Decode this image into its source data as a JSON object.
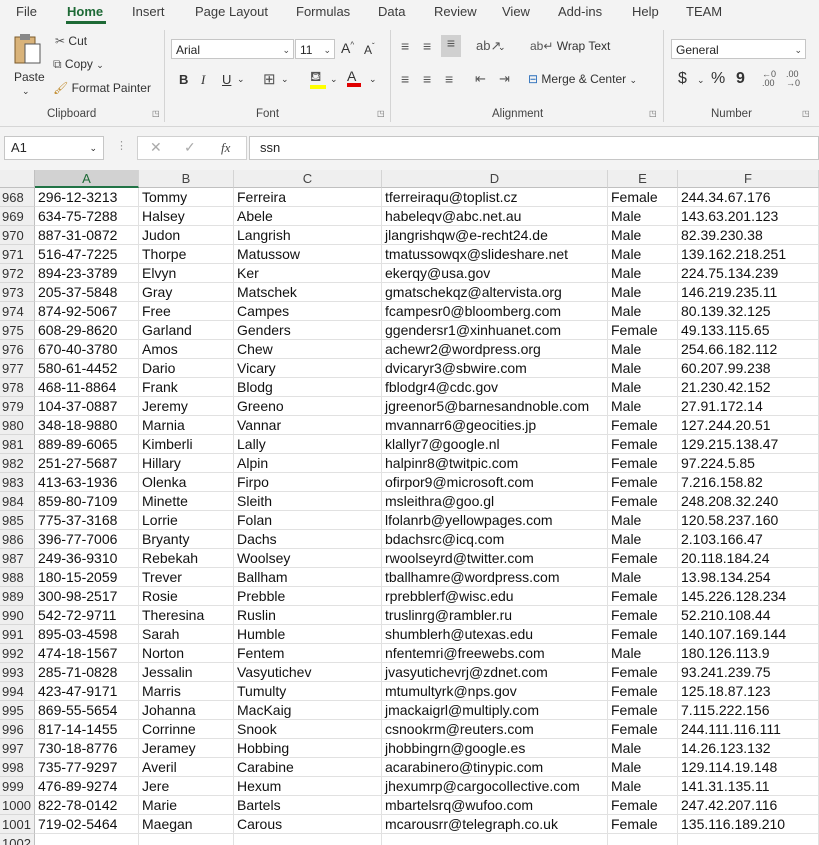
{
  "tabs": [
    "File",
    "Home",
    "Insert",
    "Page Layout",
    "Formulas",
    "Data",
    "Review",
    "View",
    "Add-ins",
    "Help",
    "TEAM"
  ],
  "active_tab": "Home",
  "clipboard": {
    "paste": "Paste",
    "cut": "Cut",
    "copy": "Copy",
    "format_painter": "Format Painter",
    "label": "Clipboard"
  },
  "font": {
    "name": "Arial",
    "size": "11",
    "bold": "B",
    "italic": "I",
    "underline": "U",
    "label": "Font"
  },
  "alignment": {
    "wrap": "Wrap Text",
    "merge": "Merge & Center",
    "label": "Alignment"
  },
  "number": {
    "format": "General",
    "currency": "$",
    "percent": "%",
    "comma": "9",
    "label": "Number"
  },
  "formula_bar": {
    "name_box": "A1",
    "fx": "fx",
    "content": "ssn"
  },
  "columns": [
    "A",
    "B",
    "C",
    "D",
    "E",
    "F"
  ],
  "rows": [
    {
      "n": "968",
      "cells": [
        "296-12-3213",
        "Tommy",
        "Ferreira",
        "tferreiraqu@toplist.cz",
        "Female",
        "244.34.67.176"
      ]
    },
    {
      "n": "969",
      "cells": [
        "634-75-7288",
        "Halsey",
        "Abele",
        "habeleqv@abc.net.au",
        "Male",
        "143.63.201.123"
      ]
    },
    {
      "n": "970",
      "cells": [
        "887-31-0872",
        "Judon",
        "Langrish",
        "jlangrishqw@e-recht24.de",
        "Male",
        "82.39.230.38"
      ]
    },
    {
      "n": "971",
      "cells": [
        "516-47-7225",
        "Thorpe",
        "Matussow",
        "tmatussowqx@slideshare.net",
        "Male",
        "139.162.218.251"
      ]
    },
    {
      "n": "972",
      "cells": [
        "894-23-3789",
        "Elvyn",
        "Ker",
        "ekerqy@usa.gov",
        "Male",
        "224.75.134.239"
      ]
    },
    {
      "n": "973",
      "cells": [
        "205-37-5848",
        "Gray",
        "Matschek",
        "gmatschekqz@altervista.org",
        "Male",
        "146.219.235.11"
      ]
    },
    {
      "n": "974",
      "cells": [
        "874-92-5067",
        "Free",
        "Campes",
        "fcampesr0@bloomberg.com",
        "Male",
        "80.139.32.125"
      ]
    },
    {
      "n": "975",
      "cells": [
        "608-29-8620",
        "Garland",
        "Genders",
        "ggendersr1@xinhuanet.com",
        "Female",
        "49.133.115.65"
      ]
    },
    {
      "n": "976",
      "cells": [
        "670-40-3780",
        "Amos",
        "Chew",
        "achewr2@wordpress.org",
        "Male",
        "254.66.182.112"
      ]
    },
    {
      "n": "977",
      "cells": [
        "580-61-4452",
        "Dario",
        "Vicary",
        "dvicaryr3@sbwire.com",
        "Male",
        "60.207.99.238"
      ]
    },
    {
      "n": "978",
      "cells": [
        "468-11-8864",
        "Frank",
        "Blodg",
        "fblodgr4@cdc.gov",
        "Male",
        "21.230.42.152"
      ]
    },
    {
      "n": "979",
      "cells": [
        "104-37-0887",
        "Jeremy",
        "Greeno",
        "jgreenor5@barnesandnoble.com",
        "Male",
        "27.91.172.14"
      ]
    },
    {
      "n": "980",
      "cells": [
        "348-18-9880",
        "Marnia",
        "Vannar",
        "mvannarr6@geocities.jp",
        "Female",
        "127.244.20.51"
      ]
    },
    {
      "n": "981",
      "cells": [
        "889-89-6065",
        "Kimberli",
        "Lally",
        "klallyr7@google.nl",
        "Female",
        "129.215.138.47"
      ]
    },
    {
      "n": "982",
      "cells": [
        "251-27-5687",
        "Hillary",
        "Alpin",
        "halpinr8@twitpic.com",
        "Female",
        "97.224.5.85"
      ]
    },
    {
      "n": "983",
      "cells": [
        "413-63-1936",
        "Olenka",
        "Firpo",
        "ofirpor9@microsoft.com",
        "Female",
        "7.216.158.82"
      ]
    },
    {
      "n": "984",
      "cells": [
        "859-80-7109",
        "Minette",
        "Sleith",
        "msleithra@goo.gl",
        "Female",
        "248.208.32.240"
      ]
    },
    {
      "n": "985",
      "cells": [
        "775-37-3168",
        "Lorrie",
        "Folan",
        "lfolanrb@yellowpages.com",
        "Male",
        "120.58.237.160"
      ]
    },
    {
      "n": "986",
      "cells": [
        "396-77-7006",
        "Bryanty",
        "Dachs",
        "bdachsrc@icq.com",
        "Male",
        "2.103.166.47"
      ]
    },
    {
      "n": "987",
      "cells": [
        "249-36-9310",
        "Rebekah",
        "Woolsey",
        "rwoolseyrd@twitter.com",
        "Female",
        "20.118.184.24"
      ]
    },
    {
      "n": "988",
      "cells": [
        "180-15-2059",
        "Trever",
        "Ballham",
        "tballhamre@wordpress.com",
        "Male",
        "13.98.134.254"
      ]
    },
    {
      "n": "989",
      "cells": [
        "300-98-2517",
        "Rosie",
        "Prebble",
        "rprebblerf@wisc.edu",
        "Female",
        "145.226.128.234"
      ]
    },
    {
      "n": "990",
      "cells": [
        "542-72-9711",
        "Theresina",
        "Ruslin",
        "truslinrg@rambler.ru",
        "Female",
        "52.210.108.44"
      ]
    },
    {
      "n": "991",
      "cells": [
        "895-03-4598",
        "Sarah",
        "Humble",
        "shumblerh@utexas.edu",
        "Female",
        "140.107.169.144"
      ]
    },
    {
      "n": "992",
      "cells": [
        "474-18-1567",
        "Norton",
        "Fentem",
        "nfentemri@freewebs.com",
        "Male",
        "180.126.113.9"
      ]
    },
    {
      "n": "993",
      "cells": [
        "285-71-0828",
        "Jessalin",
        "Vasyutichev",
        "jvasyutichevrj@zdnet.com",
        "Female",
        "93.241.239.75"
      ]
    },
    {
      "n": "994",
      "cells": [
        "423-47-9171",
        "Marris",
        "Tumulty",
        "mtumultyrk@nps.gov",
        "Female",
        "125.18.87.123"
      ]
    },
    {
      "n": "995",
      "cells": [
        "869-55-5654",
        "Johanna",
        "MacKaig",
        "jmackaigrl@multiply.com",
        "Female",
        "7.115.222.156"
      ]
    },
    {
      "n": "996",
      "cells": [
        "817-14-1455",
        "Corrinne",
        "Snook",
        "csnookrm@reuters.com",
        "Female",
        "244.111.116.111"
      ]
    },
    {
      "n": "997",
      "cells": [
        "730-18-8776",
        "Jeramey",
        "Hobbing",
        "jhobbingrn@google.es",
        "Male",
        "14.26.123.132"
      ]
    },
    {
      "n": "998",
      "cells": [
        "735-77-9297",
        "Averil",
        "Carabine",
        "acarabinero@tinypic.com",
        "Male",
        "129.114.19.148"
      ]
    },
    {
      "n": "999",
      "cells": [
        "476-89-9274",
        "Jere",
        "Hexum",
        "jhexumrp@cargocollective.com",
        "Male",
        "141.31.135.11"
      ]
    },
    {
      "n": "1000",
      "cells": [
        "822-78-0142",
        "Marie",
        "Bartels",
        "mbartelsrq@wufoo.com",
        "Female",
        "247.42.207.116"
      ]
    },
    {
      "n": "1001",
      "cells": [
        "719-02-5464",
        "Maegan",
        "Carous",
        "mcarousrr@telegraph.co.uk",
        "Female",
        "135.116.189.210"
      ]
    },
    {
      "n": "1002",
      "cells": [
        "",
        "",
        "",
        "",
        "",
        ""
      ]
    }
  ]
}
